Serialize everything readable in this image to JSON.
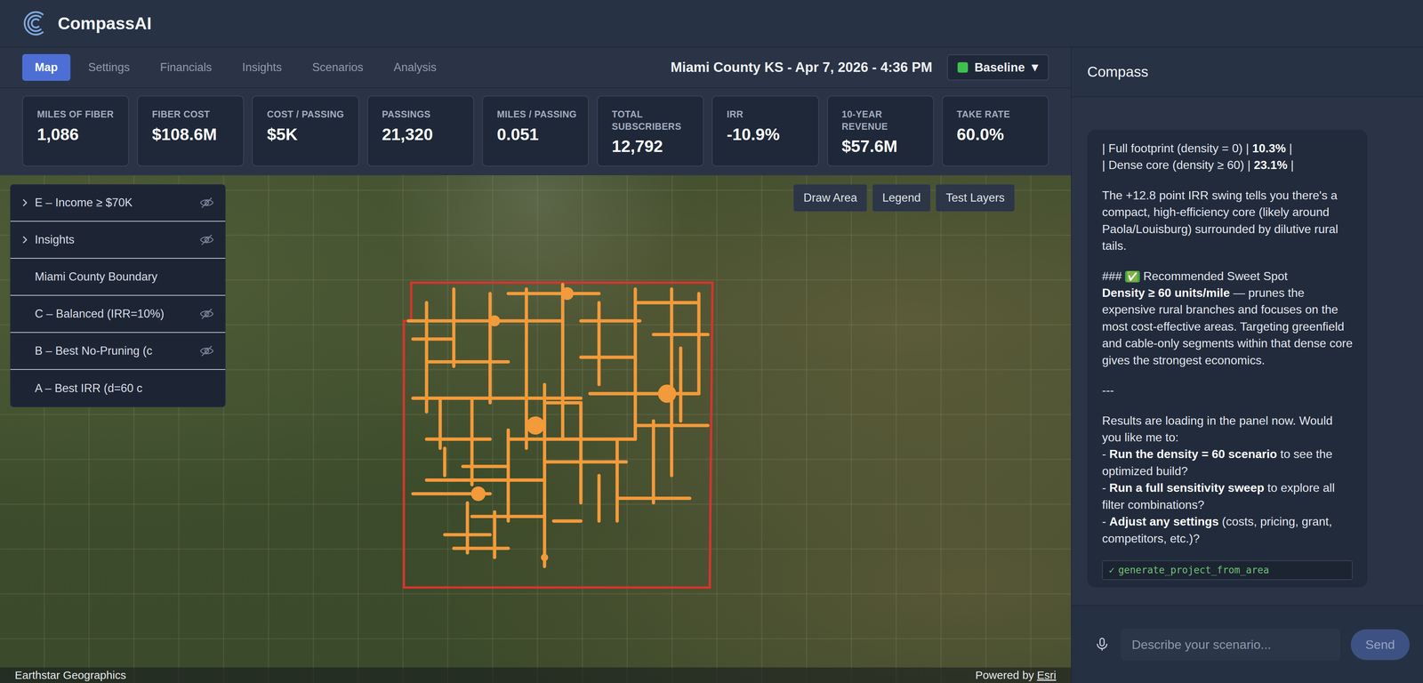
{
  "header": {
    "brand": "CompassAI"
  },
  "tabs": [
    {
      "label": "Map",
      "selected": true
    },
    {
      "label": "Settings",
      "selected": false
    },
    {
      "label": "Financials",
      "selected": false
    },
    {
      "label": "Insights",
      "selected": false
    },
    {
      "label": "Scenarios",
      "selected": false
    },
    {
      "label": "Analysis",
      "selected": false
    }
  ],
  "location": "Miami County KS - Apr 7, 2026 - 4:36 PM",
  "scenario": {
    "label": "Baseline",
    "caret": "▼"
  },
  "kpis": [
    {
      "label": "MILES OF FIBER",
      "value": "1,086"
    },
    {
      "label": "FIBER COST",
      "value": "$108.6M"
    },
    {
      "label": "COST / PASSING",
      "value": "$5K"
    },
    {
      "label": "PASSINGS",
      "value": "21,320"
    },
    {
      "label": "MILES / PASSING",
      "value": "0.051"
    },
    {
      "label": "TOTAL SUBSCRIBERS",
      "value": "12,792"
    },
    {
      "label": "IRR",
      "value": "-10.9%"
    },
    {
      "label": "10-YEAR REVENUE",
      "value": "$57.6M"
    },
    {
      "label": "TAKE RATE",
      "value": "60.0%"
    }
  ],
  "map": {
    "layers": [
      {
        "label": "E – Income ≥ $70K",
        "expandable": true,
        "hidden": true
      },
      {
        "label": "Insights",
        "expandable": true,
        "hidden": true
      },
      {
        "label": "Miami County Boundary",
        "expandable": false,
        "hidden": false
      },
      {
        "label": "C – Balanced (IRR=10%)",
        "expandable": false,
        "hidden": true
      },
      {
        "label": "B – Best No-Pruning (c",
        "expandable": false,
        "hidden": true
      },
      {
        "label": "A – Best IRR (d=60 c",
        "expandable": false,
        "hidden": false
      }
    ],
    "buttons": [
      "Draw Area",
      "Legend",
      "Test Layers"
    ],
    "attribution": "Earthstar Geographics",
    "powered_by": "Powered by",
    "powered_link": "Esri"
  },
  "chat": {
    "title": "Compass",
    "paragraphs": [
      {
        "lines": [
          [
            {
              "kind": "text",
              "text": "| Full footprint (density = 0) | "
            },
            {
              "kind": "bold",
              "text": "10.3%"
            },
            {
              "kind": "text",
              "text": " |"
            }
          ],
          [
            {
              "kind": "text",
              "text": "| Dense core (density ≥ 60) | "
            },
            {
              "kind": "bold",
              "text": "23.1%"
            },
            {
              "kind": "text",
              "text": " |"
            }
          ]
        ]
      },
      {
        "lines": [
          [
            {
              "kind": "text",
              "text": "The +12.8 point IRR swing tells you there's a compact, high-efficiency core (likely around Paola/Louisburg) surrounded by dilutive rural tails."
            }
          ]
        ]
      },
      {
        "lines": [
          [
            {
              "kind": "text",
              "text": "### "
            },
            {
              "kind": "emoji",
              "text": "✅"
            },
            {
              "kind": "text",
              "text": " Recommended Sweet Spot"
            }
          ],
          [
            {
              "kind": "bold",
              "text": "Density ≥ 60 units/mile"
            },
            {
              "kind": "text",
              "text": " — prunes the expensive rural branches and focuses on the most cost-effective areas. Targeting greenfield and cable-only segments within that dense core gives the strongest economics."
            }
          ]
        ]
      },
      {
        "lines": [
          [
            {
              "kind": "text",
              "text": "---"
            }
          ]
        ]
      },
      {
        "lines": [
          [
            {
              "kind": "text",
              "text": "Results are loading in the panel now. Would you like me to:"
            }
          ],
          [
            {
              "kind": "text",
              "text": "- "
            },
            {
              "kind": "bold",
              "text": "Run the density = 60 scenario"
            },
            {
              "kind": "text",
              "text": " to see the optimized build?"
            }
          ],
          [
            {
              "kind": "text",
              "text": "- "
            },
            {
              "kind": "bold",
              "text": "Run a full sensitivity sweep"
            },
            {
              "kind": "text",
              "text": " to explore all filter combinations?"
            }
          ],
          [
            {
              "kind": "text",
              "text": "- "
            },
            {
              "kind": "bold",
              "text": "Adjust any settings"
            },
            {
              "kind": "text",
              "text": " (costs, pricing, grant, competitors, etc.)?"
            }
          ]
        ]
      }
    ],
    "tool": {
      "icon": "✓",
      "name": "generate_project_from_area"
    },
    "input_placeholder": "Describe your scenario...",
    "send": {
      "label": "Send",
      "disabled": true
    }
  }
}
